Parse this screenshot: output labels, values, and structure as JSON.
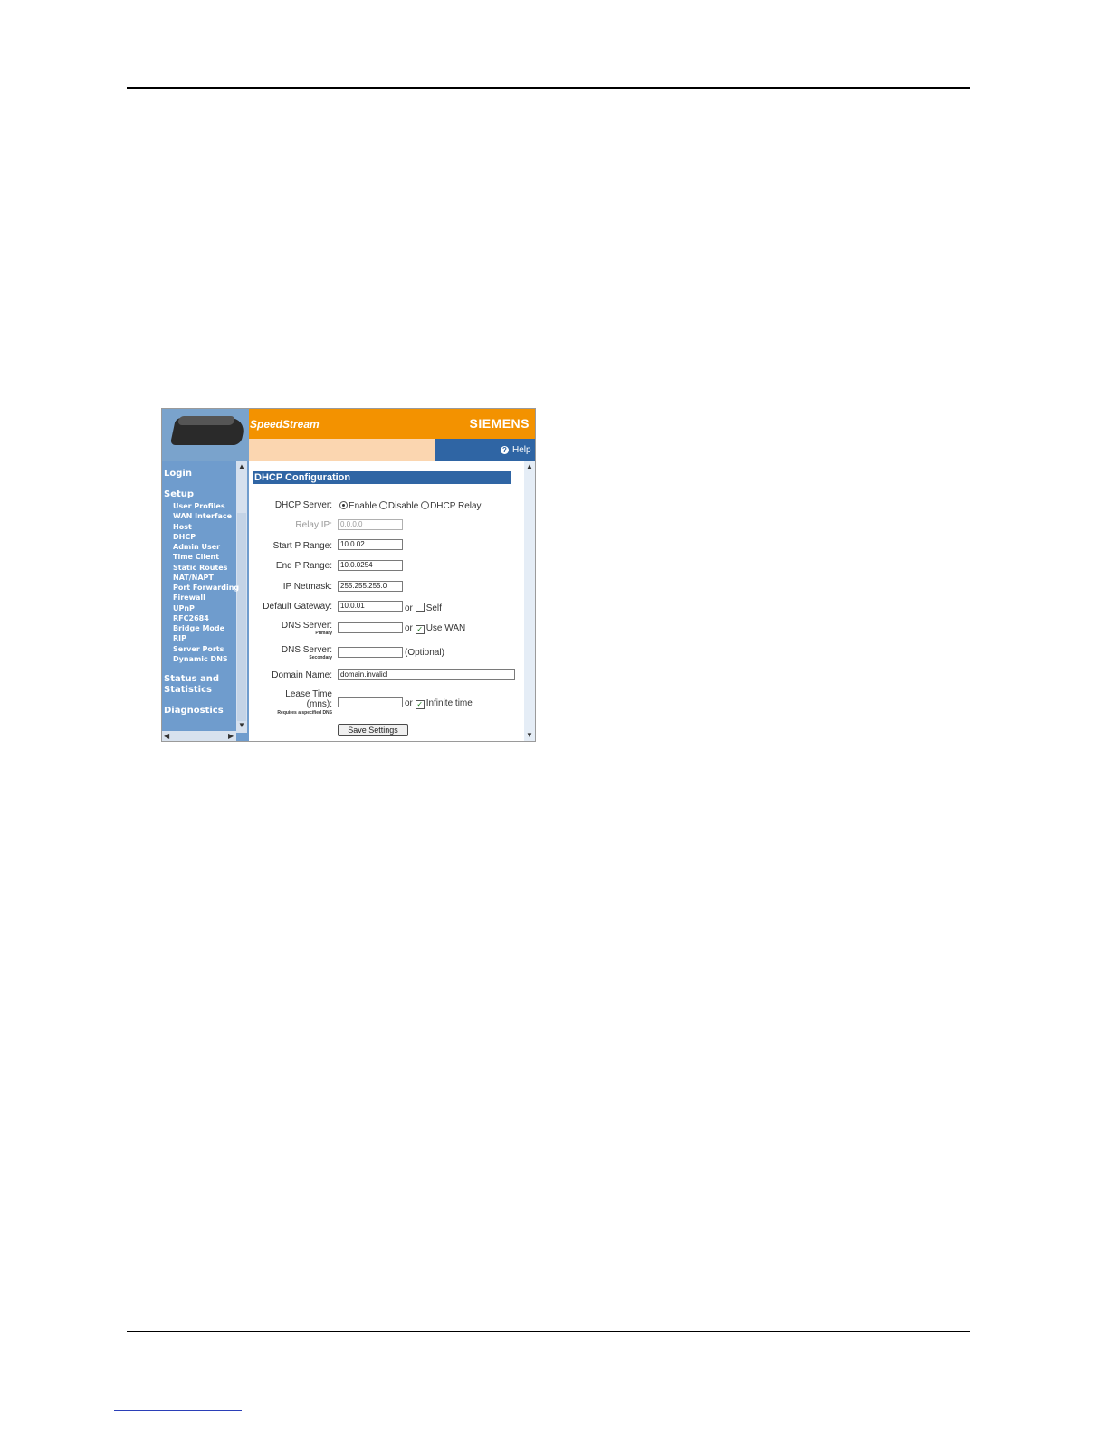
{
  "header": {
    "brand_left": "SpeedStream",
    "brand_right": "SIEMENS",
    "help_label": "Help"
  },
  "sidebar": {
    "login": "Login",
    "setup": "Setup",
    "setup_items": [
      "User Profiles",
      "WAN Interface",
      "Host",
      "DHCP",
      "Admin User",
      "Time Client",
      "Static Routes",
      "NAT/NAPT",
      "Port Forwarding",
      "Firewall",
      "UPnP",
      "RFC2684",
      "Bridge Mode",
      "RIP",
      "Server Ports",
      "Dynamic DNS"
    ],
    "status_line1": "Status and",
    "status_line2": "Statistics",
    "diagnostics": "Diagnostics"
  },
  "form": {
    "title": "DHCP Configuration",
    "dhcp_server_label": "DHCP Server:",
    "opt_enable": "Enable",
    "opt_disable": "Disable",
    "opt_relay": "DHCP Relay",
    "relay_ip_label": "Relay IP:",
    "relay_ip_value": "0.0.0.0",
    "start_ip_label": "Start P Range:",
    "start_ip_value": "10.0.02",
    "end_ip_label": "End P Range:",
    "end_ip_value": "10.0.0254",
    "netmask_label": "IP Netmask:",
    "netmask_value": "255.255.255.0",
    "gateway_label": "Default Gateway:",
    "gateway_value": "10.0.01",
    "or": "or",
    "self_label": "Self",
    "dns_label": "DNS Server:",
    "dns_primary_sub": "Primary",
    "use_wan_label": "Use WAN",
    "dns_secondary_sub": "Secondary",
    "optional_label": "(Optional)",
    "domain_label": "Domain Name:",
    "domain_value": "domain.invalid",
    "lease_label_1": "Lease Time",
    "lease_label_2": "(mns):",
    "lease_sub": "Requires a specified DNS",
    "infinite_label": "Infinite time",
    "save_label": "Save Settings"
  }
}
